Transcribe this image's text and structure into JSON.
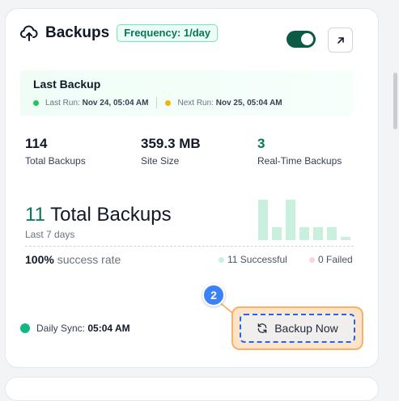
{
  "card": {
    "title": "Backups",
    "frequency_badge": "Frequency: 1/day",
    "toggle_on": true
  },
  "last_backup": {
    "title": "Last Backup",
    "last_run_label": "Last Run:",
    "last_run_value": "Nov 24, 05:04 AM",
    "next_run_label": "Next Run:",
    "next_run_value": "Nov 25, 05:04 AM"
  },
  "stats": [
    {
      "value": "114",
      "label": "Total Backups"
    },
    {
      "value": "359.3 MB",
      "label": "Site Size"
    },
    {
      "value": "3",
      "label": "Real-Time Backups"
    }
  ],
  "summary": {
    "total_number": "11",
    "total_label": "Total Backups",
    "period": "Last 7 days",
    "success_pct": "100%",
    "success_label": "success rate",
    "successful_legend": "11 Successful",
    "failed_legend": "0 Failed"
  },
  "mini_chart": {
    "values": [
      1.0,
      0.32,
      1.0,
      0.32,
      0.32,
      0.32,
      0.08
    ]
  },
  "sync": {
    "label": "Daily Sync:",
    "time": "05:04 AM"
  },
  "actions": {
    "backup_now": "Backup Now",
    "step_number": "2"
  },
  "colors": {
    "accent_green": "#047857",
    "toggle_bg": "#0b5a44",
    "success_dot": "#22c55e",
    "next_run_dot": "#f5b301",
    "highlight_orange": "#f6b26b",
    "focus_blue": "#2563eb",
    "bar_fill": "#c9f0df"
  },
  "icons": {
    "title_icon": "cloud-upload-icon",
    "external_icon": "arrow-up-right-icon",
    "button_icon": "refresh-icon"
  }
}
